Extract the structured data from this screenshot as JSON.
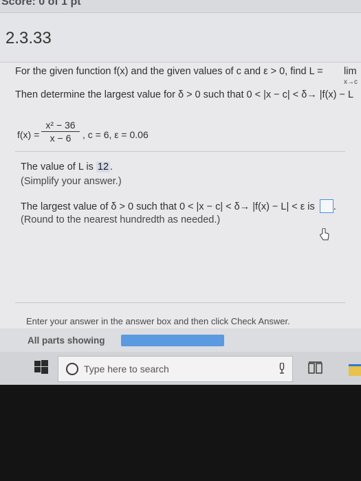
{
  "score": {
    "text": "Score: 0 of 1 pt"
  },
  "question": {
    "number": "2.3.33"
  },
  "prompt": {
    "line1_prefix": "For the given function f(x) and the given values of c and ε > 0, find L =",
    "lim_word": "lim",
    "lim_sub": "x→c",
    "line2": "Then determine the largest value for δ > 0 such that 0 < |x − c| < δ→ |f(x) − L"
  },
  "function": {
    "label": "f(x) =",
    "numerator": "x² − 36",
    "denominator": "x − 6",
    "params": ",   c = 6,   ε = 0.06"
  },
  "part1": {
    "prefix": "The value of L is",
    "answer": "12",
    "suffix": ".",
    "hint": "(Simplify your answer.)"
  },
  "part2": {
    "prefix": "The largest value of δ > 0 such that 0 < |x − c| < δ→ |f(x) − L| < ε is",
    "suffix": ".",
    "hint": "(Round to the nearest hundredth as needed.)"
  },
  "footer": {
    "instruction": "Enter your answer in the answer box and then click Check Answer.",
    "all_parts": "All parts showing"
  },
  "taskbar": {
    "search_placeholder": "Type here to search"
  }
}
